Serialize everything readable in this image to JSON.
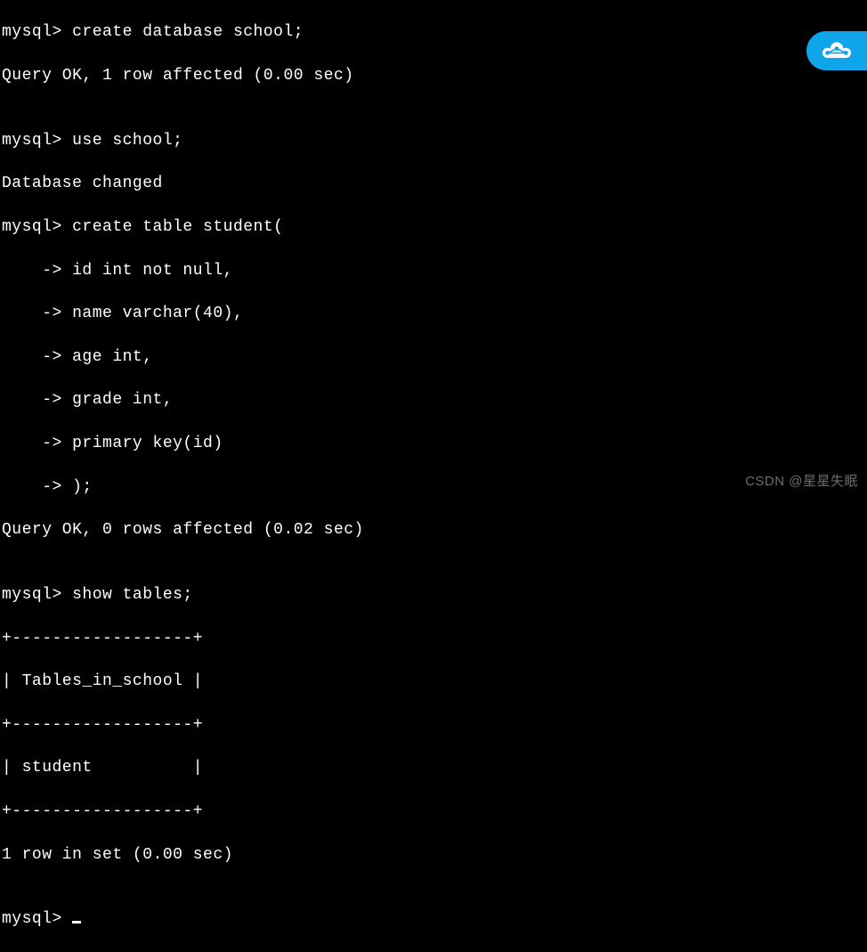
{
  "terminal": {
    "lines": [
      "mysql> create database school;",
      "Query OK, 1 row affected (0.00 sec)",
      "",
      "mysql> use school;",
      "Database changed",
      "mysql> create table student(",
      "    -> id int not null,",
      "    -> name varchar(40),",
      "    -> age int,",
      "    -> grade int,",
      "    -> primary key(id)",
      "    -> );",
      "Query OK, 0 rows affected (0.02 sec)",
      "",
      "mysql> show tables;",
      "+------------------+",
      "| Tables_in_school |",
      "+------------------+",
      "| student          |",
      "+------------------+",
      "1 row in set (0.00 sec)",
      "",
      "mysql> "
    ]
  },
  "watermark": {
    "text": "CSDN @星星失眠"
  },
  "badge": {
    "icon": "cloud-icon"
  }
}
